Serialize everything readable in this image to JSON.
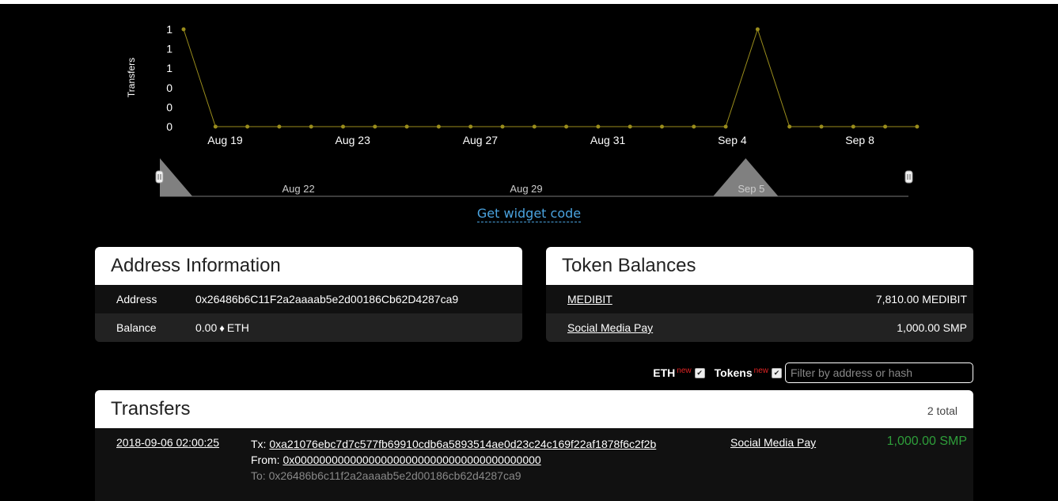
{
  "chart_data": {
    "type": "line",
    "ylabel": "Transfers",
    "y_tick_labels": [
      "1",
      "1",
      "1",
      "0",
      "0",
      "0"
    ],
    "x_tick_labels": [
      "Aug 19",
      "Aug 23",
      "Aug 27",
      "Aug 31",
      "Sep 4",
      "Sep 8"
    ],
    "x": [
      "Aug 18",
      "Aug 19",
      "Aug 20",
      "Aug 21",
      "Aug 22",
      "Aug 23",
      "Aug 24",
      "Aug 25",
      "Aug 26",
      "Aug 27",
      "Aug 28",
      "Aug 29",
      "Aug 30",
      "Aug 31",
      "Sep 1",
      "Sep 2",
      "Sep 3",
      "Sep 4",
      "Sep 5",
      "Sep 6",
      "Sep 7",
      "Sep 8",
      "Sep 9",
      "Sep 10"
    ],
    "values": [
      1,
      0,
      0,
      0,
      0,
      0,
      0,
      0,
      0,
      0,
      0,
      0,
      0,
      0,
      0,
      0,
      0,
      0,
      1,
      0,
      0,
      0,
      0,
      0
    ],
    "ylim": [
      0,
      1
    ],
    "color": "#9a8d1c",
    "navigator_tick_labels": [
      "Aug 22",
      "Aug 29",
      "Sep 5"
    ]
  },
  "widget": {
    "label": "Get widget code"
  },
  "address_info": {
    "title": "Address Information",
    "address_label": "Address",
    "address_value": "0x26486b6C11F2a2aaaab5e2d00186Cb62D4287ca9",
    "balance_label": "Balance",
    "balance_value": "0.00",
    "balance_unit": "ETH",
    "eth_icon": "♦"
  },
  "token_balances": {
    "title": "Token Balances",
    "items": [
      {
        "name": "MEDIBIT",
        "value": "7,810.00 MEDIBIT"
      },
      {
        "name": "Social Media Pay",
        "value": "1,000.00 SMP"
      }
    ]
  },
  "filters": {
    "eth_label": "ETH",
    "tokens_label": "Tokens",
    "new_badge": "new",
    "check": "✔",
    "placeholder": "Filter by address or hash"
  },
  "transfers": {
    "title": "Transfers",
    "total": "2 total",
    "rows": [
      {
        "date": "2018-09-06 02:00:25",
        "tx_label": "Tx:",
        "tx": "0xa21076ebc7d7c577fb69910cdb6a5893514ae0d23c24c169f22af1878f6c2f2b",
        "from_label": "From:",
        "from": "0x0000000000000000000000000000000000000000",
        "to_label": "To:",
        "to": "0x26486b6c11f2a2aaaab5e2d00186cb62d4287ca9",
        "token": "Social Media Pay",
        "amount": "1,000.00 SMP"
      }
    ]
  },
  "colors": {
    "accent_link": "#4aa3df",
    "amount_green": "#2e9e3a",
    "chart_line": "#9a8d1c",
    "new_badge": "#e02424"
  }
}
